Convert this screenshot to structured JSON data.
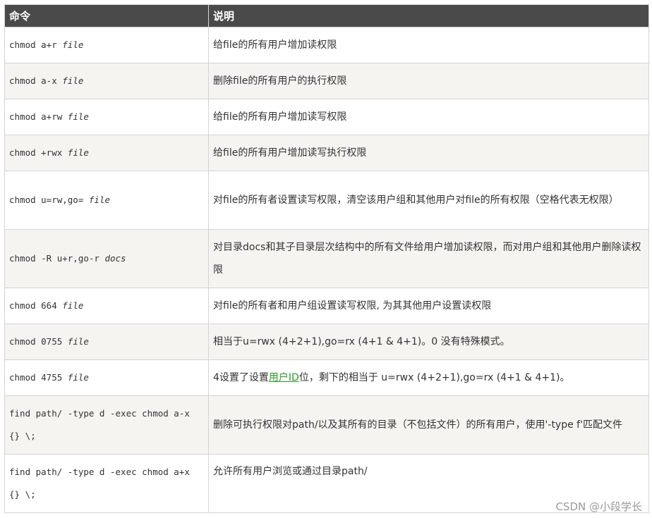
{
  "header": {
    "command": "命令",
    "description": "说明"
  },
  "rows": [
    {
      "cmd": "chmod a+r ",
      "arg": "file",
      "desc": "给file的所有用户增加读权限"
    },
    {
      "cmd": "chmod a-x ",
      "arg": "file",
      "desc": "删除file的所有用户的执行权限"
    },
    {
      "cmd": "chmod a+rw ",
      "arg": "file",
      "desc": "给file的所有用户增加读写权限"
    },
    {
      "cmd": "chmod +rwx ",
      "arg": "file",
      "desc": "给file的所有用户增加读写执行权限"
    },
    {
      "cmd": "chmod u=rw,go= ",
      "arg": "file",
      "desc": "对file的所有者设置读写权限，清空该用户组和其他用户对file的所有权限（空格代表无权限）"
    },
    {
      "cmd": "chmod -R u+r,go-r ",
      "arg": "docs",
      "desc": "对目录docs和其子目录层次结构中的所有文件给用户增加读权限，而对用户组和其他用户删除读权限"
    },
    {
      "cmd": "chmod 664 ",
      "arg": "file",
      "desc": "对file的所有者和用户组设置读写权限, 为其其他用户设置读权限"
    },
    {
      "cmd": "chmod 0755 ",
      "arg": "file",
      "desc": "相当于u=rwx (4+2+1),go=rx (4+1 & 4+1)。0 没有特殊模式。"
    },
    {
      "cmd": "chmod 4755 ",
      "arg": "file",
      "desc_before": "4设置了设置",
      "desc_link": "用户ID",
      "desc_after": "位，剩下的相当于 u=rwx (4+2+1),go=rx (4+1 & 4+1)。"
    },
    {
      "cmd": "find path/ -type d -exec chmod a-x {} \\;",
      "arg": "",
      "desc": "删除可执行权限对path/以及其所有的目录（不包括文件）的所有用户，使用'-type f'匹配文件"
    },
    {
      "cmd": "find path/ -type d -exec chmod a+x {} \\;",
      "arg": "",
      "desc": "允许所有用户浏览或通过目录path/"
    }
  ],
  "watermark": "CSDN @小段学长"
}
